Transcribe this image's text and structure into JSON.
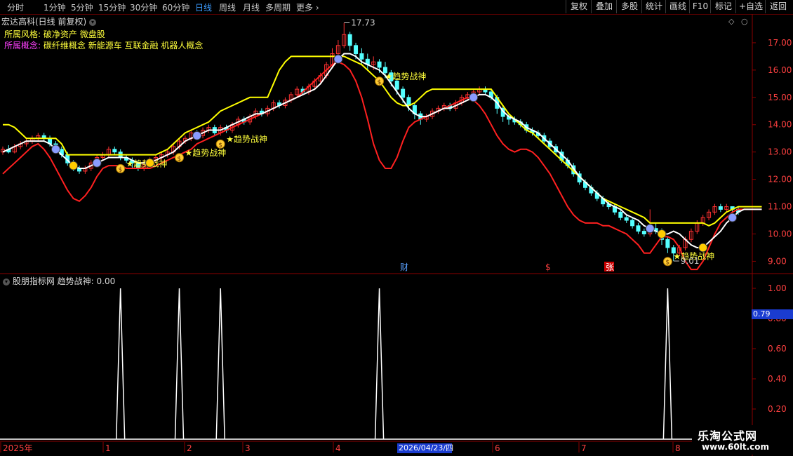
{
  "toolbar": {
    "timeframes": [
      {
        "label": "分时",
        "active": false
      },
      {
        "label": "1分钟",
        "active": false
      },
      {
        "label": "5分钟",
        "active": false
      },
      {
        "label": "15分钟",
        "active": false
      },
      {
        "label": "30分钟",
        "active": false
      },
      {
        "label": "60分钟",
        "active": false
      },
      {
        "label": "日线",
        "active": true
      },
      {
        "label": "周线",
        "active": false
      },
      {
        "label": "月线",
        "active": false
      },
      {
        "label": "多周期",
        "active": false
      },
      {
        "label": "更多",
        "active": false
      }
    ],
    "buttons": [
      "复权",
      "叠加",
      "多股",
      "统计",
      "画线",
      "F10",
      "标记",
      "+自选",
      "返回"
    ]
  },
  "stock": {
    "title": "宏达高科(日线 前复权)",
    "style_label": "所属风格:",
    "style_value": "破净资产 微盘股",
    "concept_label": "所属概念:",
    "concept_value": "碳纤维概念 新能源车 互联金融 机器人概念"
  },
  "price_axis": {
    "ticks": [
      "17.00",
      "16.00",
      "15.00",
      "14.00",
      "13.00",
      "12.00",
      "11.00",
      "10.00",
      "9.00"
    ]
  },
  "annotations": {
    "high": "17.73",
    "low": "9.01",
    "signal_label": "趋势战神",
    "markers": [
      "财",
      "$",
      "张"
    ]
  },
  "indicator": {
    "title": "股朋指标网 趋势战神: 0.00",
    "ticks": [
      "1.00",
      "0.80",
      "0.60",
      "0.40",
      "0.20"
    ],
    "hover_value": "0.79"
  },
  "date_axis": {
    "labels": [
      "2025年",
      "1",
      "2",
      "3",
      "4",
      "2026/04/23/四",
      "6",
      "7",
      "8"
    ]
  },
  "watermark": {
    "line1": "乐淘公式网",
    "line2": "www.60lt.com"
  },
  "colors": {
    "up": "#ff3232",
    "down": "#54ffff",
    "yellow_line": "#ffff00",
    "white_line": "#ffffff",
    "red_line": "#ff2020",
    "axis": "#8b0000",
    "signal_text": "#ffff3c"
  },
  "chart_data": {
    "type": "line",
    "price_range": [
      8.6,
      18.0
    ],
    "candles": [
      [
        13.0,
        13.1,
        13.2,
        12.9
      ],
      [
        13.1,
        13.0,
        13.25,
        12.95
      ],
      [
        13.0,
        13.2,
        13.3,
        12.95
      ],
      [
        13.2,
        13.3,
        13.4,
        13.1
      ],
      [
        13.3,
        13.4,
        13.5,
        13.2
      ],
      [
        13.4,
        13.5,
        13.6,
        13.3
      ],
      [
        13.5,
        13.6,
        13.7,
        13.4
      ],
      [
        13.6,
        13.5,
        13.7,
        13.4
      ],
      [
        13.5,
        13.3,
        13.6,
        13.2
      ],
      [
        13.3,
        13.1,
        13.4,
        13.0
      ],
      [
        13.1,
        12.9,
        13.2,
        12.8
      ],
      [
        12.9,
        12.6,
        13.0,
        12.5
      ],
      [
        12.6,
        12.4,
        12.7,
        12.3
      ],
      [
        12.4,
        12.3,
        12.5,
        12.2
      ],
      [
        12.3,
        12.4,
        12.5,
        12.2
      ],
      [
        12.4,
        12.6,
        12.7,
        12.3
      ],
      [
        12.6,
        12.8,
        12.9,
        12.5
      ],
      [
        12.8,
        12.9,
        13.0,
        12.7
      ],
      [
        12.9,
        13.1,
        13.2,
        12.8
      ],
      [
        13.1,
        13.0,
        13.2,
        12.9
      ],
      [
        13.0,
        12.8,
        13.1,
        12.7
      ],
      [
        12.8,
        12.7,
        12.9,
        12.6
      ],
      [
        12.7,
        12.6,
        12.8,
        12.4
      ],
      [
        12.6,
        12.4,
        12.7,
        12.3
      ],
      [
        12.4,
        12.6,
        12.7,
        12.3
      ],
      [
        12.6,
        12.7,
        12.8,
        12.5
      ],
      [
        12.7,
        12.8,
        12.9,
        12.6
      ],
      [
        12.8,
        12.9,
        13.0,
        12.7
      ],
      [
        12.9,
        13.0,
        13.1,
        12.8
      ],
      [
        13.0,
        13.2,
        13.3,
        12.9
      ],
      [
        13.2,
        13.4,
        13.5,
        13.1
      ],
      [
        13.4,
        13.5,
        13.6,
        13.3
      ],
      [
        13.5,
        13.7,
        13.8,
        13.4
      ],
      [
        13.7,
        13.6,
        13.8,
        13.5
      ],
      [
        13.6,
        13.8,
        13.9,
        13.5
      ],
      [
        13.8,
        13.9,
        14.0,
        13.7
      ],
      [
        13.9,
        13.7,
        14.0,
        13.6
      ],
      [
        13.7,
        13.9,
        14.0,
        13.6
      ],
      [
        13.9,
        13.8,
        14.0,
        13.7
      ],
      [
        13.8,
        14.0,
        14.1,
        13.7
      ],
      [
        14.0,
        14.2,
        14.3,
        13.9
      ],
      [
        14.2,
        14.1,
        14.3,
        14.0
      ],
      [
        14.1,
        14.3,
        14.4,
        14.0
      ],
      [
        14.3,
        14.5,
        14.6,
        14.2
      ],
      [
        14.5,
        14.4,
        14.6,
        14.3
      ],
      [
        14.4,
        14.6,
        14.7,
        14.3
      ],
      [
        14.6,
        14.8,
        14.9,
        14.5
      ],
      [
        14.8,
        14.7,
        14.9,
        14.6
      ],
      [
        14.7,
        14.9,
        15.0,
        14.6
      ],
      [
        14.9,
        15.1,
        15.2,
        14.8
      ],
      [
        15.1,
        15.3,
        15.4,
        15.0
      ],
      [
        15.3,
        15.2,
        15.4,
        15.1
      ],
      [
        15.2,
        15.4,
        15.5,
        15.1
      ],
      [
        15.4,
        15.6,
        15.7,
        15.3
      ],
      [
        15.6,
        15.8,
        15.9,
        15.5
      ],
      [
        15.8,
        16.2,
        16.3,
        15.7
      ],
      [
        16.2,
        16.6,
        16.8,
        16.1
      ],
      [
        16.6,
        16.9,
        17.1,
        16.5
      ],
      [
        16.9,
        17.3,
        17.73,
        16.8
      ],
      [
        17.3,
        16.9,
        17.4,
        16.7
      ],
      [
        16.9,
        16.6,
        17.0,
        16.4
      ],
      [
        16.6,
        16.4,
        16.8,
        16.2
      ],
      [
        16.4,
        16.2,
        16.6,
        16.0
      ],
      [
        16.2,
        16.3,
        16.5,
        16.0
      ],
      [
        16.3,
        16.1,
        16.4,
        15.9
      ],
      [
        16.1,
        15.9,
        16.3,
        15.7
      ],
      [
        15.9,
        15.6,
        16.0,
        15.4
      ],
      [
        15.6,
        15.3,
        15.7,
        15.1
      ],
      [
        15.3,
        15.0,
        15.4,
        14.8
      ],
      [
        15.0,
        14.7,
        15.1,
        14.5
      ],
      [
        14.7,
        14.4,
        14.8,
        14.2
      ],
      [
        14.4,
        14.2,
        14.5,
        14.0
      ],
      [
        14.2,
        14.3,
        14.4,
        14.1
      ],
      [
        14.3,
        14.5,
        14.6,
        14.2
      ],
      [
        14.5,
        14.6,
        14.7,
        14.4
      ],
      [
        14.6,
        14.7,
        14.8,
        14.5
      ],
      [
        14.7,
        14.6,
        14.8,
        14.5
      ],
      [
        14.6,
        14.8,
        14.9,
        14.5
      ],
      [
        14.8,
        15.0,
        15.1,
        14.7
      ],
      [
        15.0,
        15.1,
        15.2,
        14.9
      ],
      [
        15.1,
        15.2,
        15.3,
        15.0
      ],
      [
        15.2,
        15.3,
        15.4,
        15.1
      ],
      [
        15.3,
        15.2,
        15.4,
        15.1
      ],
      [
        15.2,
        15.0,
        15.3,
        14.9
      ],
      [
        15.0,
        14.6,
        15.1,
        14.4
      ],
      [
        14.6,
        14.3,
        14.7,
        14.1
      ],
      [
        14.3,
        14.2,
        14.4,
        14.0
      ],
      [
        14.2,
        14.1,
        14.3,
        14.0
      ],
      [
        14.1,
        14.0,
        14.2,
        13.9
      ],
      [
        14.0,
        13.8,
        14.1,
        13.7
      ],
      [
        13.8,
        13.7,
        13.9,
        13.6
      ],
      [
        13.7,
        13.6,
        13.8,
        13.5
      ],
      [
        13.6,
        13.4,
        13.7,
        13.3
      ],
      [
        13.4,
        13.2,
        13.5,
        13.1
      ],
      [
        13.2,
        13.0,
        13.3,
        12.9
      ],
      [
        13.0,
        12.7,
        13.1,
        12.6
      ],
      [
        12.7,
        12.5,
        12.8,
        12.4
      ],
      [
        12.5,
        12.2,
        12.6,
        12.1
      ],
      [
        12.2,
        11.9,
        12.3,
        11.8
      ],
      [
        11.9,
        11.7,
        12.0,
        11.6
      ],
      [
        11.7,
        11.5,
        11.8,
        11.4
      ],
      [
        11.5,
        11.3,
        11.6,
        11.2
      ],
      [
        11.3,
        11.1,
        11.4,
        11.0
      ],
      [
        11.1,
        11.0,
        11.2,
        10.9
      ],
      [
        11.0,
        10.8,
        11.1,
        10.7
      ],
      [
        10.8,
        10.6,
        10.9,
        10.5
      ],
      [
        10.6,
        10.5,
        10.7,
        10.4
      ],
      [
        10.5,
        10.3,
        10.6,
        10.2
      ],
      [
        10.3,
        10.1,
        10.4,
        10.0
      ],
      [
        10.1,
        10.0,
        10.2,
        9.9
      ],
      [
        10.0,
        10.2,
        10.9,
        9.9
      ],
      [
        10.2,
        10.1,
        10.4,
        10.0
      ],
      [
        10.1,
        9.8,
        10.2,
        9.6
      ],
      [
        9.8,
        9.5,
        9.9,
        9.3
      ],
      [
        9.5,
        9.3,
        9.6,
        9.01
      ],
      [
        9.3,
        9.5,
        9.6,
        9.2
      ],
      [
        9.5,
        9.8,
        9.9,
        9.4
      ],
      [
        9.8,
        10.1,
        10.2,
        9.7
      ],
      [
        10.1,
        10.4,
        10.5,
        10.0
      ],
      [
        10.4,
        10.6,
        10.7,
        10.3
      ],
      [
        10.6,
        10.8,
        10.9,
        10.5
      ],
      [
        10.8,
        11.0,
        11.1,
        10.7
      ],
      [
        11.0,
        10.9,
        11.1,
        10.8
      ],
      [
        10.9,
        11.0,
        11.1,
        10.8
      ],
      [
        11.0,
        10.9,
        11.0,
        10.8
      ],
      [
        10.9,
        10.8,
        11.0,
        10.7
      ]
    ],
    "yellow_line": [
      14.0,
      14.0,
      13.9,
      13.7,
      13.5,
      13.5,
      13.5,
      13.5,
      13.5,
      13.5,
      13.3,
      12.9,
      12.9,
      12.9,
      12.9,
      12.9,
      12.9,
      12.9,
      12.9,
      12.9,
      12.9,
      12.9,
      12.9,
      12.9,
      12.9,
      12.9,
      12.9,
      13.0,
      13.1,
      13.3,
      13.5,
      13.7,
      13.8,
      13.9,
      14.0,
      14.1,
      14.3,
      14.5,
      14.6,
      14.7,
      14.8,
      14.9,
      15.0,
      15.0,
      15.0,
      15.0,
      15.5,
      16.0,
      16.3,
      16.5,
      16.5,
      16.5,
      16.5,
      16.5,
      16.5,
      16.5,
      16.5,
      16.5,
      16.5,
      16.4,
      16.3,
      16.2,
      16.0,
      15.8,
      15.6,
      15.3,
      15.0,
      14.8,
      14.7,
      14.7,
      14.8,
      15.0,
      15.2,
      15.3,
      15.3,
      15.3,
      15.3,
      15.3,
      15.3,
      15.3,
      15.3,
      15.3,
      15.3,
      15.3,
      15.0,
      14.7,
      14.4,
      14.2,
      14.0,
      13.8,
      13.7,
      13.5,
      13.3,
      13.1,
      12.9,
      12.7,
      12.5,
      12.3,
      12.1,
      11.9,
      11.7,
      11.5,
      11.3,
      11.2,
      11.1,
      11.0,
      10.9,
      10.8,
      10.7,
      10.6,
      10.4,
      10.4,
      10.4,
      10.4,
      10.4,
      10.4,
      10.4,
      10.4,
      10.4,
      10.4,
      10.3,
      10.4,
      10.6,
      10.8,
      10.9,
      11.0,
      11.0,
      11.0,
      11.0,
      11.0
    ],
    "white_line": [
      13.0,
      13.1,
      13.2,
      13.3,
      13.4,
      13.4,
      13.4,
      13.4,
      13.3,
      13.1,
      12.9,
      12.7,
      12.5,
      12.4,
      12.4,
      12.5,
      12.6,
      12.7,
      12.8,
      12.8,
      12.8,
      12.8,
      12.7,
      12.6,
      12.6,
      12.6,
      12.7,
      12.8,
      12.9,
      13.0,
      13.2,
      13.4,
      13.5,
      13.6,
      13.7,
      13.8,
      13.8,
      13.8,
      13.9,
      14.0,
      14.1,
      14.2,
      14.3,
      14.4,
      14.4,
      14.5,
      14.6,
      14.7,
      14.8,
      14.9,
      15.0,
      15.1,
      15.2,
      15.3,
      15.5,
      15.8,
      16.1,
      16.4,
      16.6,
      16.6,
      16.5,
      16.3,
      16.2,
      16.1,
      16.0,
      15.8,
      15.5,
      15.2,
      14.9,
      14.6,
      14.4,
      14.3,
      14.3,
      14.4,
      14.5,
      14.6,
      14.6,
      14.7,
      14.8,
      14.9,
      15.0,
      15.1,
      15.1,
      15.0,
      14.8,
      14.5,
      14.3,
      14.2,
      14.1,
      13.9,
      13.8,
      13.7,
      13.5,
      13.3,
      13.1,
      12.9,
      12.7,
      12.4,
      12.1,
      11.9,
      11.7,
      11.5,
      11.3,
      11.1,
      11.0,
      10.9,
      10.7,
      10.6,
      10.5,
      10.3,
      10.2,
      10.1,
      10.0,
      10.0,
      10.1,
      10.0,
      9.8,
      9.6,
      9.5,
      9.5,
      9.7,
      9.9,
      10.1,
      10.4,
      10.6,
      10.8,
      10.9,
      10.9,
      10.9,
      10.9
    ],
    "red_line": [
      12.2,
      12.4,
      12.6,
      12.8,
      13.0,
      13.2,
      13.3,
      13.1,
      12.8,
      12.4,
      12.0,
      11.6,
      11.3,
      11.2,
      11.4,
      11.7,
      12.1,
      12.4,
      12.5,
      12.5,
      12.5,
      12.4,
      12.4,
      12.4,
      12.4,
      12.4,
      12.5,
      12.6,
      12.7,
      12.8,
      12.9,
      13.0,
      13.1,
      13.3,
      13.4,
      13.5,
      13.6,
      13.7,
      13.8,
      13.9,
      14.0,
      14.1,
      14.2,
      14.3,
      14.4,
      14.5,
      14.6,
      14.7,
      14.8,
      14.9,
      15.0,
      15.2,
      15.4,
      15.6,
      15.8,
      16.0,
      16.2,
      16.3,
      16.2,
      16.0,
      15.6,
      15.0,
      14.2,
      13.3,
      12.7,
      12.4,
      12.4,
      12.8,
      13.4,
      13.9,
      14.1,
      14.2,
      14.3,
      14.4,
      14.5,
      14.6,
      14.7,
      14.8,
      14.9,
      15.0,
      14.9,
      14.7,
      14.4,
      14.0,
      13.6,
      13.3,
      13.1,
      13.0,
      13.1,
      13.1,
      13.0,
      12.8,
      12.5,
      12.2,
      11.8,
      11.4,
      11.0,
      10.7,
      10.5,
      10.4,
      10.4,
      10.4,
      10.3,
      10.3,
      10.2,
      10.1,
      10.0,
      9.8,
      9.6,
      9.3,
      9.3,
      9.6,
      9.9,
      9.9,
      9.8,
      9.5,
      9.0,
      8.7,
      8.7,
      9.0,
      9.5,
      10.0,
      10.4,
      10.6,
      10.8,
      10.9,
      10.9,
      10.9,
      10.9,
      10.9
    ],
    "signal_indices": [
      20,
      30,
      37,
      64,
      113
    ],
    "indicator_values": [
      0,
      0,
      0,
      0,
      0,
      0,
      0,
      0,
      0,
      0,
      0,
      0,
      0,
      0,
      0,
      0,
      0,
      0,
      0,
      0,
      1,
      0,
      0,
      0,
      0,
      0,
      0,
      0,
      0,
      0,
      1,
      0,
      0,
      0,
      0,
      0,
      0,
      1,
      0,
      0,
      0,
      0,
      0,
      0,
      0,
      0,
      0,
      0,
      0,
      0,
      0,
      0,
      0,
      0,
      0,
      0,
      0,
      0,
      0,
      0,
      0,
      0,
      0,
      0,
      1,
      0,
      0,
      0,
      0,
      0,
      0,
      0,
      0,
      0,
      0,
      0,
      0,
      0,
      0,
      0,
      0,
      0,
      0,
      0,
      0,
      0,
      0,
      0,
      0,
      0,
      0,
      0,
      0,
      0,
      0,
      0,
      0,
      0,
      0,
      0,
      0,
      0,
      0,
      0,
      0,
      0,
      0,
      0,
      0,
      0,
      0,
      0,
      0,
      1,
      0,
      0,
      0,
      0,
      0,
      0,
      0,
      0,
      0,
      0,
      0,
      0,
      0,
      0,
      0,
      0
    ]
  }
}
